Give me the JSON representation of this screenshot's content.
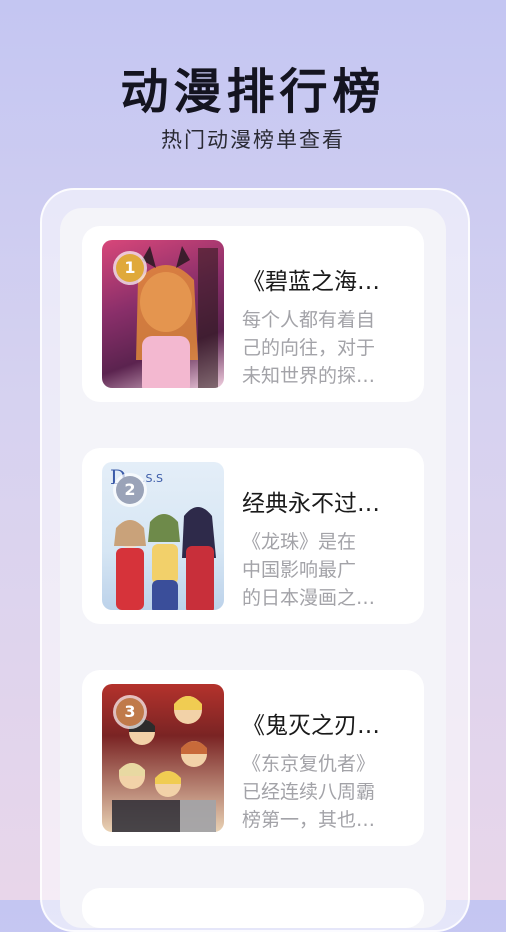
{
  "header": {
    "title": "动漫排行榜",
    "subtitle": "热门动漫榜单查看"
  },
  "ranking": [
    {
      "rank": "1",
      "badge_color": "#e0a93a",
      "title": "《碧蓝之海…",
      "desc_lines": [
        "每个人都有着自",
        "己的向往，对于",
        "未知世界的探…"
      ],
      "cover_colors": [
        "#c03a5a",
        "#6d2a5e",
        "#e8c6d6"
      ]
    },
    {
      "rank": "2",
      "badge_color": "#9aa3b8",
      "title": "经典永不过…",
      "desc_lines": [
        "《龙珠》是在",
        "中国影响最广",
        "的日本漫画之…"
      ],
      "cover_colors": [
        "#cfe2f3",
        "#d8383a",
        "#3a4e9a"
      ]
    },
    {
      "rank": "3",
      "badge_color": "#c07a4a",
      "title": "《鬼灭之刃…",
      "desc_lines": [
        "《东京复仇者》",
        "已经连续八周霸",
        "榜第一，其也…"
      ],
      "cover_colors": [
        "#b4322c",
        "#f3d9b6",
        "#2b2b35"
      ]
    }
  ]
}
